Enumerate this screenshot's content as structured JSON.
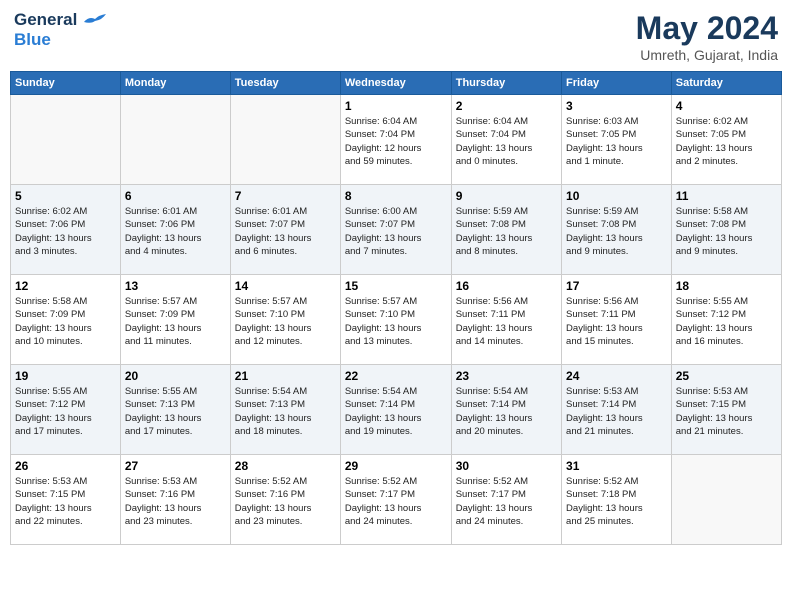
{
  "header": {
    "logo_line1": "General",
    "logo_line2": "Blue",
    "month_year": "May 2024",
    "location": "Umreth, Gujarat, India"
  },
  "weekdays": [
    "Sunday",
    "Monday",
    "Tuesday",
    "Wednesday",
    "Thursday",
    "Friday",
    "Saturday"
  ],
  "weeks": [
    [
      {
        "day": "",
        "info": ""
      },
      {
        "day": "",
        "info": ""
      },
      {
        "day": "",
        "info": ""
      },
      {
        "day": "1",
        "info": "Sunrise: 6:04 AM\nSunset: 7:04 PM\nDaylight: 12 hours\nand 59 minutes."
      },
      {
        "day": "2",
        "info": "Sunrise: 6:04 AM\nSunset: 7:04 PM\nDaylight: 13 hours\nand 0 minutes."
      },
      {
        "day": "3",
        "info": "Sunrise: 6:03 AM\nSunset: 7:05 PM\nDaylight: 13 hours\nand 1 minute."
      },
      {
        "day": "4",
        "info": "Sunrise: 6:02 AM\nSunset: 7:05 PM\nDaylight: 13 hours\nand 2 minutes."
      }
    ],
    [
      {
        "day": "5",
        "info": "Sunrise: 6:02 AM\nSunset: 7:06 PM\nDaylight: 13 hours\nand 3 minutes."
      },
      {
        "day": "6",
        "info": "Sunrise: 6:01 AM\nSunset: 7:06 PM\nDaylight: 13 hours\nand 4 minutes."
      },
      {
        "day": "7",
        "info": "Sunrise: 6:01 AM\nSunset: 7:07 PM\nDaylight: 13 hours\nand 6 minutes."
      },
      {
        "day": "8",
        "info": "Sunrise: 6:00 AM\nSunset: 7:07 PM\nDaylight: 13 hours\nand 7 minutes."
      },
      {
        "day": "9",
        "info": "Sunrise: 5:59 AM\nSunset: 7:08 PM\nDaylight: 13 hours\nand 8 minutes."
      },
      {
        "day": "10",
        "info": "Sunrise: 5:59 AM\nSunset: 7:08 PM\nDaylight: 13 hours\nand 9 minutes."
      },
      {
        "day": "11",
        "info": "Sunrise: 5:58 AM\nSunset: 7:08 PM\nDaylight: 13 hours\nand 9 minutes."
      }
    ],
    [
      {
        "day": "12",
        "info": "Sunrise: 5:58 AM\nSunset: 7:09 PM\nDaylight: 13 hours\nand 10 minutes."
      },
      {
        "day": "13",
        "info": "Sunrise: 5:57 AM\nSunset: 7:09 PM\nDaylight: 13 hours\nand 11 minutes."
      },
      {
        "day": "14",
        "info": "Sunrise: 5:57 AM\nSunset: 7:10 PM\nDaylight: 13 hours\nand 12 minutes."
      },
      {
        "day": "15",
        "info": "Sunrise: 5:57 AM\nSunset: 7:10 PM\nDaylight: 13 hours\nand 13 minutes."
      },
      {
        "day": "16",
        "info": "Sunrise: 5:56 AM\nSunset: 7:11 PM\nDaylight: 13 hours\nand 14 minutes."
      },
      {
        "day": "17",
        "info": "Sunrise: 5:56 AM\nSunset: 7:11 PM\nDaylight: 13 hours\nand 15 minutes."
      },
      {
        "day": "18",
        "info": "Sunrise: 5:55 AM\nSunset: 7:12 PM\nDaylight: 13 hours\nand 16 minutes."
      }
    ],
    [
      {
        "day": "19",
        "info": "Sunrise: 5:55 AM\nSunset: 7:12 PM\nDaylight: 13 hours\nand 17 minutes."
      },
      {
        "day": "20",
        "info": "Sunrise: 5:55 AM\nSunset: 7:13 PM\nDaylight: 13 hours\nand 17 minutes."
      },
      {
        "day": "21",
        "info": "Sunrise: 5:54 AM\nSunset: 7:13 PM\nDaylight: 13 hours\nand 18 minutes."
      },
      {
        "day": "22",
        "info": "Sunrise: 5:54 AM\nSunset: 7:14 PM\nDaylight: 13 hours\nand 19 minutes."
      },
      {
        "day": "23",
        "info": "Sunrise: 5:54 AM\nSunset: 7:14 PM\nDaylight: 13 hours\nand 20 minutes."
      },
      {
        "day": "24",
        "info": "Sunrise: 5:53 AM\nSunset: 7:14 PM\nDaylight: 13 hours\nand 21 minutes."
      },
      {
        "day": "25",
        "info": "Sunrise: 5:53 AM\nSunset: 7:15 PM\nDaylight: 13 hours\nand 21 minutes."
      }
    ],
    [
      {
        "day": "26",
        "info": "Sunrise: 5:53 AM\nSunset: 7:15 PM\nDaylight: 13 hours\nand 22 minutes."
      },
      {
        "day": "27",
        "info": "Sunrise: 5:53 AM\nSunset: 7:16 PM\nDaylight: 13 hours\nand 23 minutes."
      },
      {
        "day": "28",
        "info": "Sunrise: 5:52 AM\nSunset: 7:16 PM\nDaylight: 13 hours\nand 23 minutes."
      },
      {
        "day": "29",
        "info": "Sunrise: 5:52 AM\nSunset: 7:17 PM\nDaylight: 13 hours\nand 24 minutes."
      },
      {
        "day": "30",
        "info": "Sunrise: 5:52 AM\nSunset: 7:17 PM\nDaylight: 13 hours\nand 24 minutes."
      },
      {
        "day": "31",
        "info": "Sunrise: 5:52 AM\nSunset: 7:18 PM\nDaylight: 13 hours\nand 25 minutes."
      },
      {
        "day": "",
        "info": ""
      }
    ]
  ]
}
